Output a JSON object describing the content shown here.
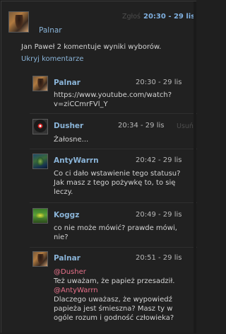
{
  "top_post": {
    "report_label": "Zgłoś",
    "time": "20:30 - 29 lis",
    "author": "Palnar",
    "text": "Jan Paweł 2 komentuje wyniki wyborów.",
    "hide_comments": "Ukryj komentarze"
  },
  "comments": [
    {
      "author": "Palnar",
      "time": "20:30 - 29 lis",
      "lines": [
        "https://www.youtube.com/watch?",
        "v=ziCCmrFVl_Y"
      ]
    },
    {
      "author": "Dusher",
      "time": "20:34 - 29 lis",
      "action": "Usuń",
      "lines": [
        "Żałosne..."
      ]
    },
    {
      "author": "AntyWarrn",
      "time": "20:42 - 29 lis",
      "lines": [
        "Co ci dało wstawienie tego statusu?",
        "Jak masz z tego pożywkę to, to się",
        "leczy."
      ]
    },
    {
      "author": "Koggz",
      "time": "20:49 - 29 lis",
      "lines": [
        "co nie może mówić? prawde mówi,",
        "nie?"
      ]
    },
    {
      "author": "Palnar",
      "time": "20:51 - 29 lis",
      "mention1": "@Dusher",
      "line2": "Też uważam, że papież przesadził.",
      "mention2": "@AntyWarrn",
      "lines_after": [
        "Dlaczego uważasz, że wypowiedź",
        "papieża jest śmieszna? Masz ty w",
        "ogóle rozum i godność człowieka?"
      ]
    }
  ],
  "colors": {
    "background": "#212121",
    "name": "#8ab4d8",
    "mention": "#e8708a",
    "text": "#d4d4d4"
  }
}
